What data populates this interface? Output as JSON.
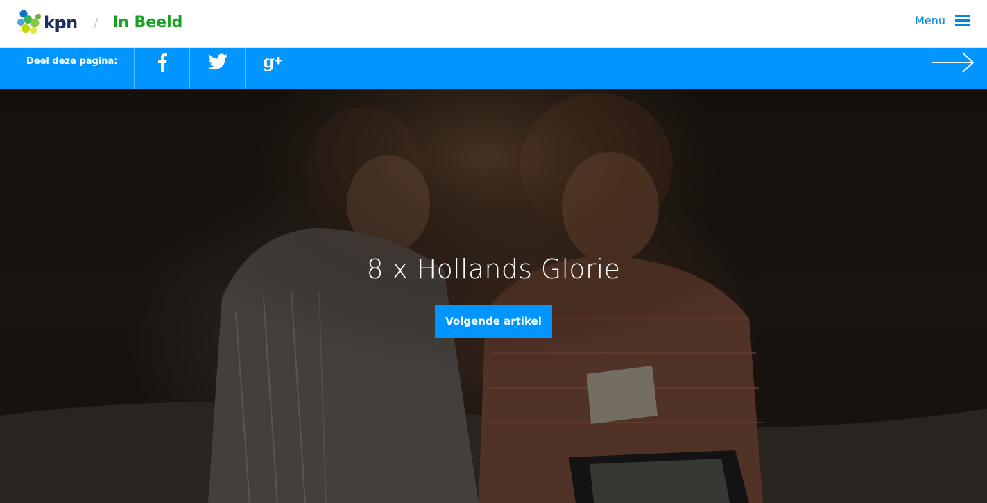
{
  "header": {
    "logo_text": "kpn",
    "divider": "/",
    "site_title": "In Beeld",
    "menu_label": "Menu"
  },
  "sharebar": {
    "label": "Deel deze pagina:",
    "buttons": [
      {
        "name": "facebook",
        "glyph": "f",
        "icon": "facebook-icon"
      },
      {
        "name": "twitter",
        "glyph": "",
        "icon": "twitter-icon"
      },
      {
        "name": "gplus",
        "glyph": "g+",
        "icon": "google-plus-icon"
      }
    ],
    "next_icon": "arrow-right-icon"
  },
  "hero": {
    "title": "8 x Hollands Glorie",
    "button_label": "Volgende artikel"
  },
  "colors": {
    "brand_blue": "#0095ff",
    "menu_blue": "#0088e0",
    "title_green": "#15a221",
    "logo_navy": "#1c2f5a"
  }
}
